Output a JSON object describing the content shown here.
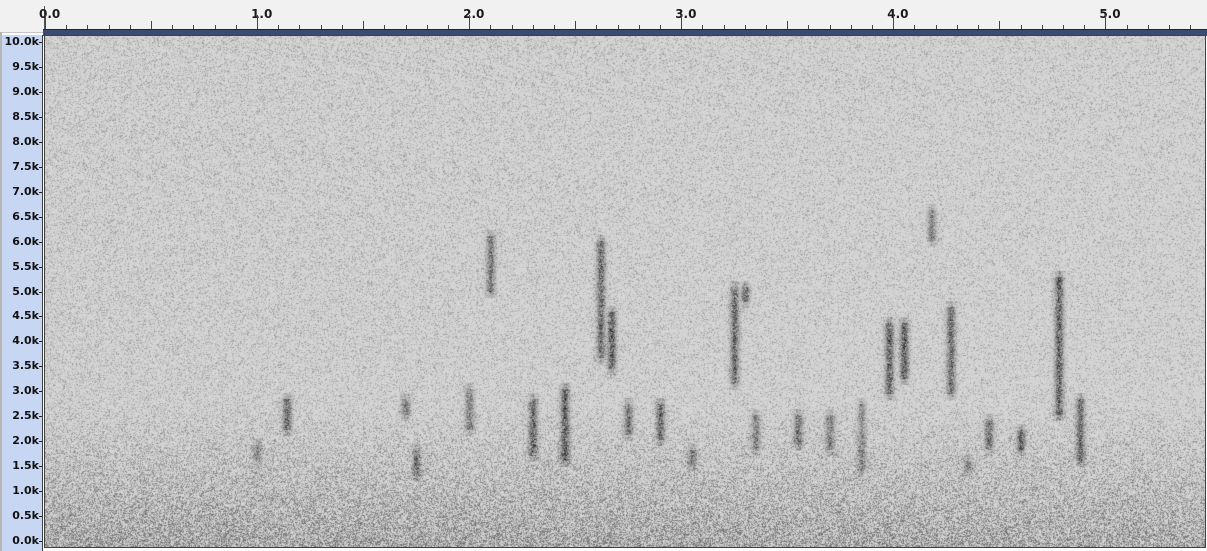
{
  "chart_data": {
    "type": "heatmap",
    "title": "",
    "xlabel": "",
    "ylabel": "",
    "x_ticks": [
      "0.0",
      "1.0",
      "2.0",
      "3.0",
      "4.0",
      "5.0"
    ],
    "x_tick_values": [
      0,
      1,
      2,
      3,
      4,
      5
    ],
    "xlim": [
      0,
      5.47
    ],
    "y_ticks": [
      "10.0k",
      "9.5k",
      "9.0k",
      "8.5k",
      "8.0k",
      "7.5k",
      "7.0k",
      "6.5k",
      "6.0k",
      "5.5k",
      "5.0k",
      "4.5k",
      "4.0k",
      "3.5k",
      "3.0k",
      "2.5k",
      "2.0k",
      "1.5k",
      "1.0k",
      "0.5k",
      "0.0k"
    ],
    "ylim": [
      0,
      10000
    ],
    "grid": false,
    "colors": {
      "background": "#d4d4d4",
      "energy": "#1a1a1a",
      "axis_bg": "#c7d6f3",
      "ruler_bg": "#f1f1f1",
      "ruler_strip": "#3c4c70"
    },
    "energy_traces": [
      {
        "t": 1.14,
        "f_low": 2300,
        "f_high": 2900,
        "intensity": 0.8
      },
      {
        "t": 1.0,
        "f_low": 1700,
        "f_high": 2000,
        "intensity": 0.5
      },
      {
        "t": 1.7,
        "f_low": 2600,
        "f_high": 2900,
        "intensity": 0.7
      },
      {
        "t": 1.75,
        "f_low": 1400,
        "f_high": 1900,
        "intensity": 0.6
      },
      {
        "t": 2.0,
        "f_low": 2300,
        "f_high": 3100,
        "intensity": 0.6
      },
      {
        "t": 2.1,
        "f_low": 5000,
        "f_high": 6100,
        "intensity": 0.7
      },
      {
        "t": 2.3,
        "f_low": 1800,
        "f_high": 2900,
        "intensity": 0.8
      },
      {
        "t": 2.45,
        "f_low": 1700,
        "f_high": 3100,
        "intensity": 0.9
      },
      {
        "t": 2.62,
        "f_low": 3700,
        "f_high": 6000,
        "intensity": 0.8
      },
      {
        "t": 2.67,
        "f_low": 3500,
        "f_high": 4600,
        "intensity": 0.9
      },
      {
        "t": 2.75,
        "f_low": 2200,
        "f_high": 2800,
        "intensity": 0.7
      },
      {
        "t": 2.9,
        "f_low": 2100,
        "f_high": 2800,
        "intensity": 0.8
      },
      {
        "t": 3.05,
        "f_low": 1600,
        "f_high": 1900,
        "intensity": 0.6
      },
      {
        "t": 3.25,
        "f_low": 3200,
        "f_high": 5100,
        "intensity": 0.8
      },
      {
        "t": 3.3,
        "f_low": 4800,
        "f_high": 5100,
        "intensity": 0.8
      },
      {
        "t": 3.35,
        "f_low": 1900,
        "f_high": 2600,
        "intensity": 0.6
      },
      {
        "t": 3.55,
        "f_low": 2000,
        "f_high": 2600,
        "intensity": 0.7
      },
      {
        "t": 3.7,
        "f_low": 1900,
        "f_high": 2600,
        "intensity": 0.6
      },
      {
        "t": 3.85,
        "f_low": 1500,
        "f_high": 2800,
        "intensity": 0.5
      },
      {
        "t": 3.98,
        "f_low": 3000,
        "f_high": 4400,
        "intensity": 0.9
      },
      {
        "t": 4.05,
        "f_low": 3300,
        "f_high": 4400,
        "intensity": 0.9
      },
      {
        "t": 4.18,
        "f_low": 6000,
        "f_high": 6600,
        "intensity": 0.6
      },
      {
        "t": 4.27,
        "f_low": 3000,
        "f_high": 4700,
        "intensity": 0.8
      },
      {
        "t": 4.35,
        "f_low": 1500,
        "f_high": 1700,
        "intensity": 0.6
      },
      {
        "t": 4.45,
        "f_low": 1900,
        "f_high": 2500,
        "intensity": 0.7
      },
      {
        "t": 4.6,
        "f_low": 1900,
        "f_high": 2300,
        "intensity": 0.8
      },
      {
        "t": 4.78,
        "f_low": 2600,
        "f_high": 5300,
        "intensity": 0.9
      },
      {
        "t": 4.88,
        "f_low": 1700,
        "f_high": 2900,
        "intensity": 0.8
      }
    ]
  }
}
